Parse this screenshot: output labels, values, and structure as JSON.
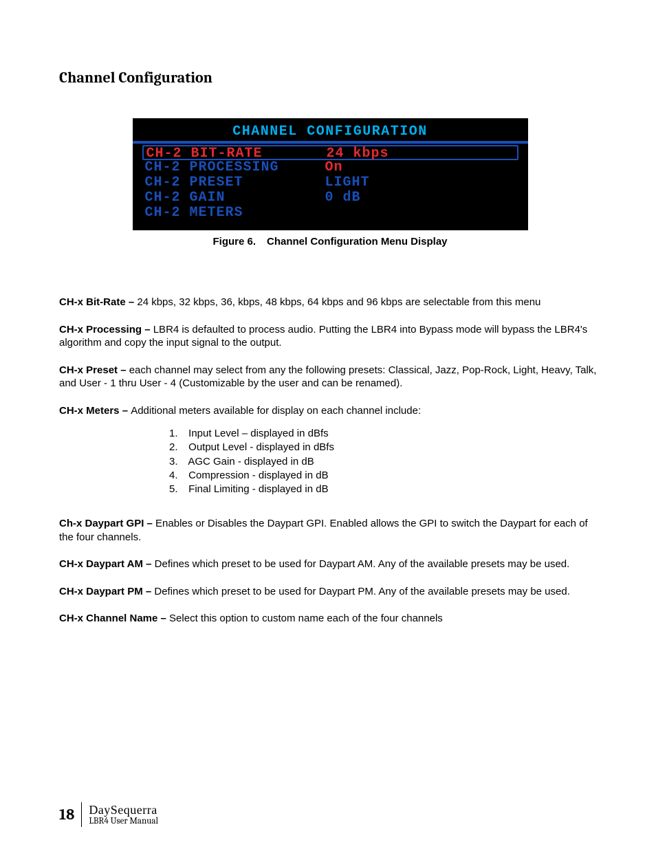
{
  "heading": "Channel Configuration",
  "lcd": {
    "title": "CHANNEL CONFIGURATION",
    "rows": [
      {
        "label": "CH-2 BIT-RATE",
        "value": "24 kbps",
        "selected": true,
        "accent": false
      },
      {
        "label": "CH-2 PROCESSING",
        "value": "On",
        "selected": false,
        "accent": true
      },
      {
        "label": "CH-2 PRESET",
        "value": "LIGHT",
        "selected": false,
        "accent": false
      },
      {
        "label": "CH-2 GAIN",
        "value": "0 dB",
        "selected": false,
        "accent": false
      },
      {
        "label": "CH-2 METERS",
        "value": "",
        "selected": false,
        "accent": false
      }
    ]
  },
  "figure": {
    "num": "Figure 6.",
    "caption": "Channel Configuration Menu Display"
  },
  "paras": {
    "bitrate": {
      "term": "CH-x Bit-Rate – ",
      "text": "24 kbps, 32 kbps, 36, kbps, 48 kbps, 64 kbps and 96 kbps are selectable from this menu"
    },
    "processing": {
      "term": "CH-x Processing – ",
      "text": "LBR4 is defaulted to process audio.  Putting the LBR4 into Bypass mode will bypass the LBR4's algorithm and copy the input signal to the output."
    },
    "preset": {
      "term": "CH-x Preset – ",
      "text": "each channel may select from any the following presets:  Classical, Jazz, Pop-Rock, Light, Heavy, Talk, and User - 1 thru User - 4 (Customizable by the user and can be renamed)."
    },
    "meters": {
      "term": "CH-x Meters – ",
      "text": "Additional meters available for display on each channel include:"
    },
    "daypart_gpi": {
      "term": "Ch-x Daypart GPI – ",
      "text": " Enables or Disables the Daypart GPI.  Enabled allows the GPI to switch the Daypart for each of the four channels."
    },
    "daypart_am": {
      "term": "CH-x Daypart AM – ",
      "text": "Defines which preset to be used for Daypart AM.  Any of the available presets may be used."
    },
    "daypart_pm": {
      "term": "CH-x Daypart PM – ",
      "text": "Defines which preset to be used for Daypart PM.  Any of the available presets may be used."
    },
    "channel_name": {
      "term": "CH-x Channel Name – ",
      "text": "Select this option to custom name each of the four channels"
    }
  },
  "meters_list": [
    "Input Level – displayed in dBfs",
    "Output Level - displayed in dBfs",
    "AGC Gain - displayed in dB",
    "Compression - displayed in dB",
    "Final Limiting - displayed in dB"
  ],
  "footer": {
    "page": "18",
    "brand": "DaySequerra",
    "manual": "LBR4 User Manual"
  }
}
